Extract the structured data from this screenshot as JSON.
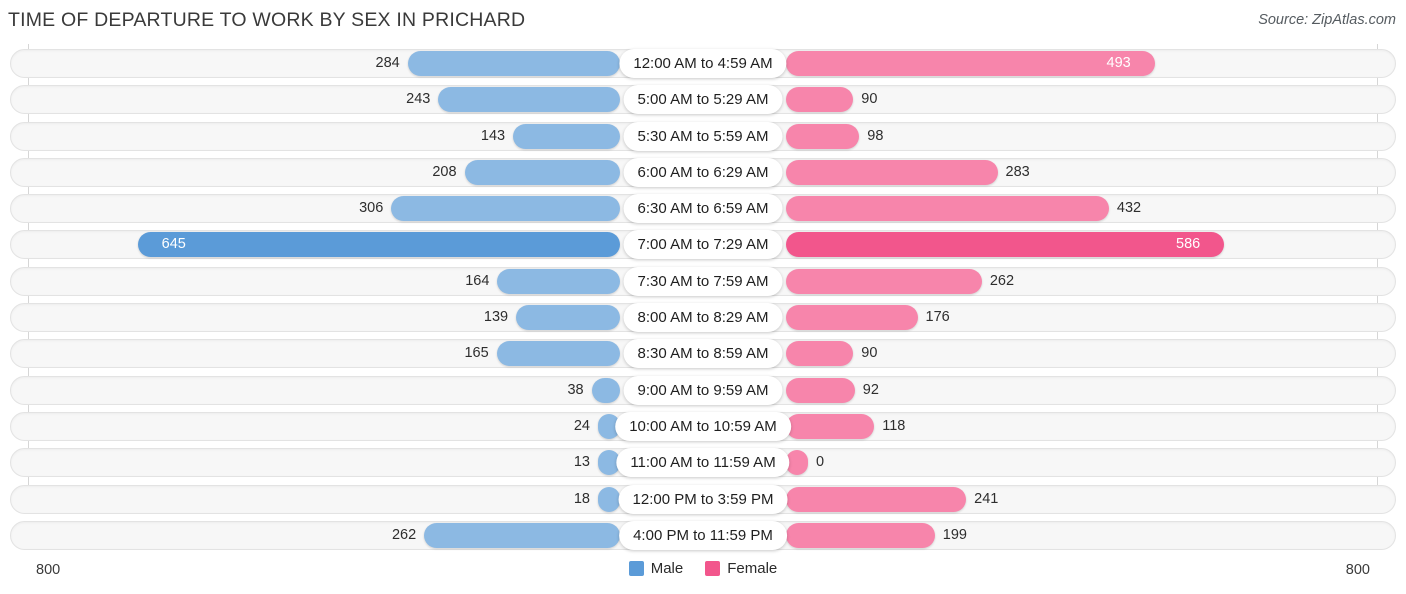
{
  "header": {
    "title": "TIME OF DEPARTURE TO WORK BY SEX IN PRICHARD",
    "source": "Source: ZipAtlas.com"
  },
  "footer": {
    "axis_left": "800",
    "axis_right": "800",
    "legend": [
      {
        "label": "Male",
        "color": "#5b9bd8"
      },
      {
        "label": "Female",
        "color": "#f2568c"
      }
    ]
  },
  "colors": {
    "male": "#8cb9e3",
    "male_highlight": "#5b9bd8",
    "female": "#f785ab",
    "female_highlight": "#f2568c",
    "track": "#f7f7f7",
    "gridline": "#d6d6d6"
  },
  "chart_data": {
    "type": "bar",
    "subtype": "diverging-bidirectional",
    "title": "TIME OF DEPARTURE TO WORK BY SEX IN PRICHARD",
    "xlabel": "",
    "ylabel": "",
    "xlim": [
      800,
      800
    ],
    "axis_tick_labels": [
      "800",
      "800"
    ],
    "grid": true,
    "legend_position": "bottom-center",
    "categories": [
      "12:00 AM to 4:59 AM",
      "5:00 AM to 5:29 AM",
      "5:30 AM to 5:59 AM",
      "6:00 AM to 6:29 AM",
      "6:30 AM to 6:59 AM",
      "7:00 AM to 7:29 AM",
      "7:30 AM to 7:59 AM",
      "8:00 AM to 8:29 AM",
      "8:30 AM to 8:59 AM",
      "9:00 AM to 9:59 AM",
      "10:00 AM to 10:59 AM",
      "11:00 AM to 11:59 AM",
      "12:00 PM to 3:59 PM",
      "4:00 PM to 11:59 PM"
    ],
    "series": [
      {
        "name": "Male",
        "direction": "left",
        "values": [
          284,
          243,
          143,
          208,
          306,
          645,
          164,
          139,
          165,
          38,
          24,
          13,
          18,
          262
        ]
      },
      {
        "name": "Female",
        "direction": "right",
        "values": [
          493,
          90,
          98,
          283,
          432,
          586,
          262,
          176,
          90,
          92,
          118,
          0,
          241,
          199
        ]
      }
    ],
    "rows": [
      {
        "category": "12:00 AM to 4:59 AM",
        "male": 284,
        "female": 493,
        "male_label_inside": false,
        "female_label_inside": true,
        "highlight": false
      },
      {
        "category": "5:00 AM to 5:29 AM",
        "male": 243,
        "female": 90,
        "male_label_inside": false,
        "female_label_inside": false,
        "highlight": false
      },
      {
        "category": "5:30 AM to 5:59 AM",
        "male": 143,
        "female": 98,
        "male_label_inside": false,
        "female_label_inside": false,
        "highlight": false
      },
      {
        "category": "6:00 AM to 6:29 AM",
        "male": 208,
        "female": 283,
        "male_label_inside": false,
        "female_label_inside": false,
        "highlight": false
      },
      {
        "category": "6:30 AM to 6:59 AM",
        "male": 306,
        "female": 432,
        "male_label_inside": false,
        "female_label_inside": false,
        "highlight": false
      },
      {
        "category": "7:00 AM to 7:29 AM",
        "male": 645,
        "female": 586,
        "male_label_inside": true,
        "female_label_inside": true,
        "highlight": true
      },
      {
        "category": "7:30 AM to 7:59 AM",
        "male": 164,
        "female": 262,
        "male_label_inside": false,
        "female_label_inside": false,
        "highlight": false
      },
      {
        "category": "8:00 AM to 8:29 AM",
        "male": 139,
        "female": 176,
        "male_label_inside": false,
        "female_label_inside": false,
        "highlight": false
      },
      {
        "category": "8:30 AM to 8:59 AM",
        "male": 165,
        "female": 90,
        "male_label_inside": false,
        "female_label_inside": false,
        "highlight": false
      },
      {
        "category": "9:00 AM to 9:59 AM",
        "male": 38,
        "female": 92,
        "male_label_inside": false,
        "female_label_inside": false,
        "highlight": false
      },
      {
        "category": "10:00 AM to 10:59 AM",
        "male": 24,
        "female": 118,
        "male_label_inside": false,
        "female_label_inside": false,
        "highlight": false
      },
      {
        "category": "11:00 AM to 11:59 AM",
        "male": 13,
        "female": 0,
        "male_label_inside": false,
        "female_label_inside": false,
        "highlight": false
      },
      {
        "category": "12:00 PM to 3:59 PM",
        "male": 18,
        "female": 241,
        "male_label_inside": false,
        "female_label_inside": false,
        "highlight": false
      },
      {
        "category": "4:00 PM to 11:59 PM",
        "male": 262,
        "female": 199,
        "male_label_inside": false,
        "female_label_inside": false,
        "highlight": false
      }
    ]
  }
}
